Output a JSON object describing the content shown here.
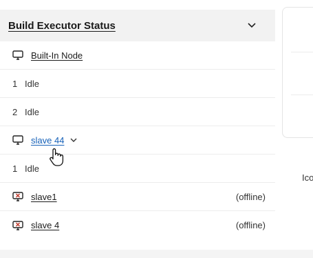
{
  "executors": {
    "title": "Build Executor Status",
    "collapse_icon": "chevron-down-icon",
    "nodes": [
      {
        "name": "Built-In Node",
        "icon": "computer-icon"
      },
      {
        "executor_1": "1",
        "executor_1_status": "Idle"
      },
      {
        "executor_2": "2",
        "executor_2_status": "Idle"
      }
    ],
    "built_in_node": {
      "name": "Built-In Node",
      "icon": "computer-icon",
      "executors": [
        {
          "num": "1",
          "status": "Idle"
        },
        {
          "num": "2",
          "status": "Idle"
        }
      ]
    },
    "slave44": {
      "name": "slave 44",
      "icon": "computer-icon",
      "menu_icon": "chevron-down-icon",
      "executors": [
        {
          "num": "1",
          "status": "Idle"
        }
      ]
    },
    "slave1": {
      "name": "slave1",
      "icon": "offline-computer-icon",
      "status": "(offline)"
    },
    "slave4": {
      "name": "slave 4",
      "icon": "offline-computer-icon",
      "status": "(offline)"
    }
  },
  "side": {
    "label": "Ico"
  },
  "colors": {
    "link_active": "#1560b8",
    "header_bg": "#f2f2f2",
    "offline_red": "#c0392b"
  }
}
